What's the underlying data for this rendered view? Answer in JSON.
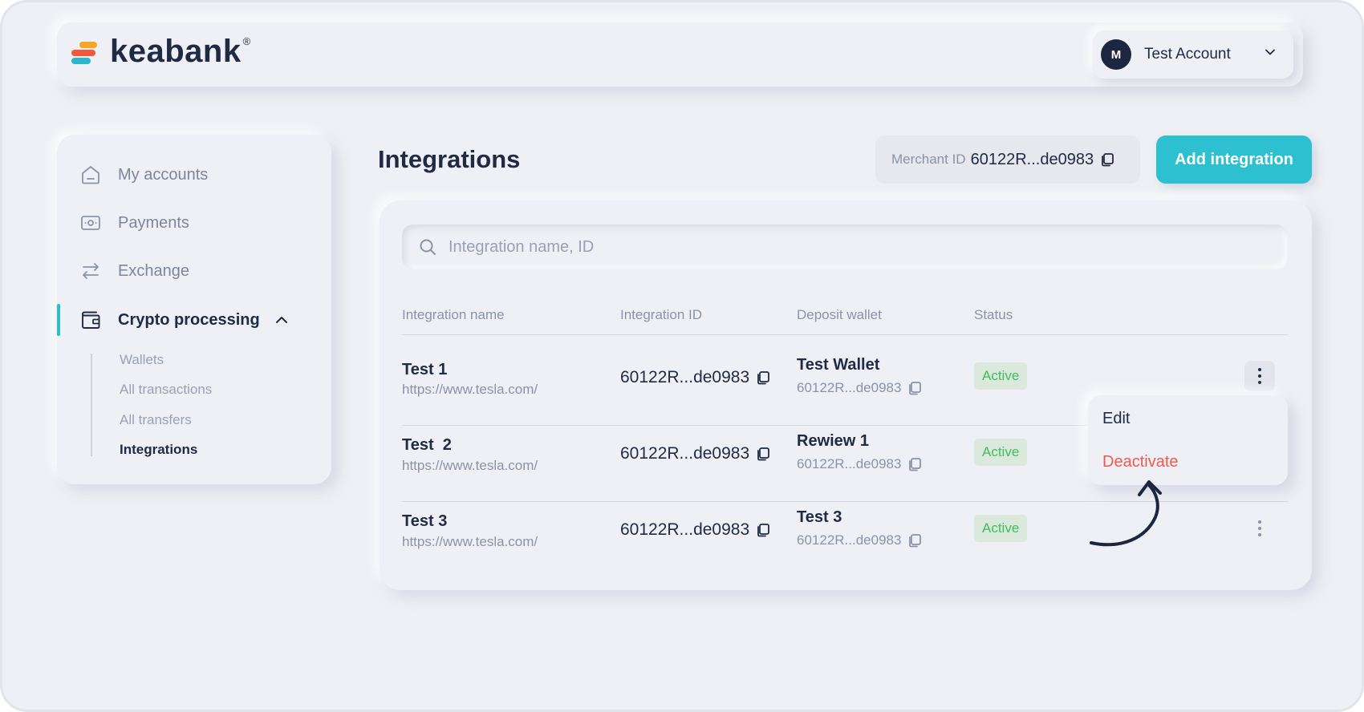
{
  "brand": {
    "name": "keabank",
    "reg_mark": "®",
    "colors": {
      "accent": "#2cc0d0",
      "dark": "#1f2a44",
      "danger": "#ef5a4a",
      "success": "#3fbf5a"
    }
  },
  "account": {
    "initial": "M",
    "name": "Test Account"
  },
  "sidebar": {
    "items": [
      {
        "label": "My accounts",
        "icon": "home-icon"
      },
      {
        "label": "Payments",
        "icon": "payments-icon"
      },
      {
        "label": "Exchange",
        "icon": "exchange-icon"
      },
      {
        "label": "Crypto processing",
        "icon": "wallet-icon"
      }
    ],
    "sub_items": [
      "Wallets",
      "All transactions",
      "All transfers",
      "Integrations"
    ]
  },
  "page": {
    "title": "Integrations"
  },
  "merchant": {
    "label": "Merchant ID",
    "value": "60122R...de0983"
  },
  "add_button": "Add integration",
  "search": {
    "placeholder": "Integration name, ID"
  },
  "table": {
    "headers": [
      "Integration name",
      "Integration ID",
      "Deposit wallet",
      "Status"
    ],
    "rows": [
      {
        "name": "Test 1",
        "url": "https://www.tesla.com/",
        "id": "60122R...de0983",
        "wallet": "Test Wallet",
        "wallet_id": "60122R...de0983",
        "status": "Active"
      },
      {
        "name": "Test  2",
        "url": "https://www.tesla.com/",
        "id": "60122R...de0983",
        "wallet": "Rewiew 1",
        "wallet_id": "60122R...de0983",
        "status": "Active"
      },
      {
        "name": "Test 3",
        "url": "https://www.tesla.com/",
        "id": "60122R...de0983",
        "wallet": "Test 3",
        "wallet_id": "60122R...de0983",
        "status": "Active"
      }
    ]
  },
  "row_menu": {
    "edit": "Edit",
    "deactivate": "Deactivate"
  }
}
